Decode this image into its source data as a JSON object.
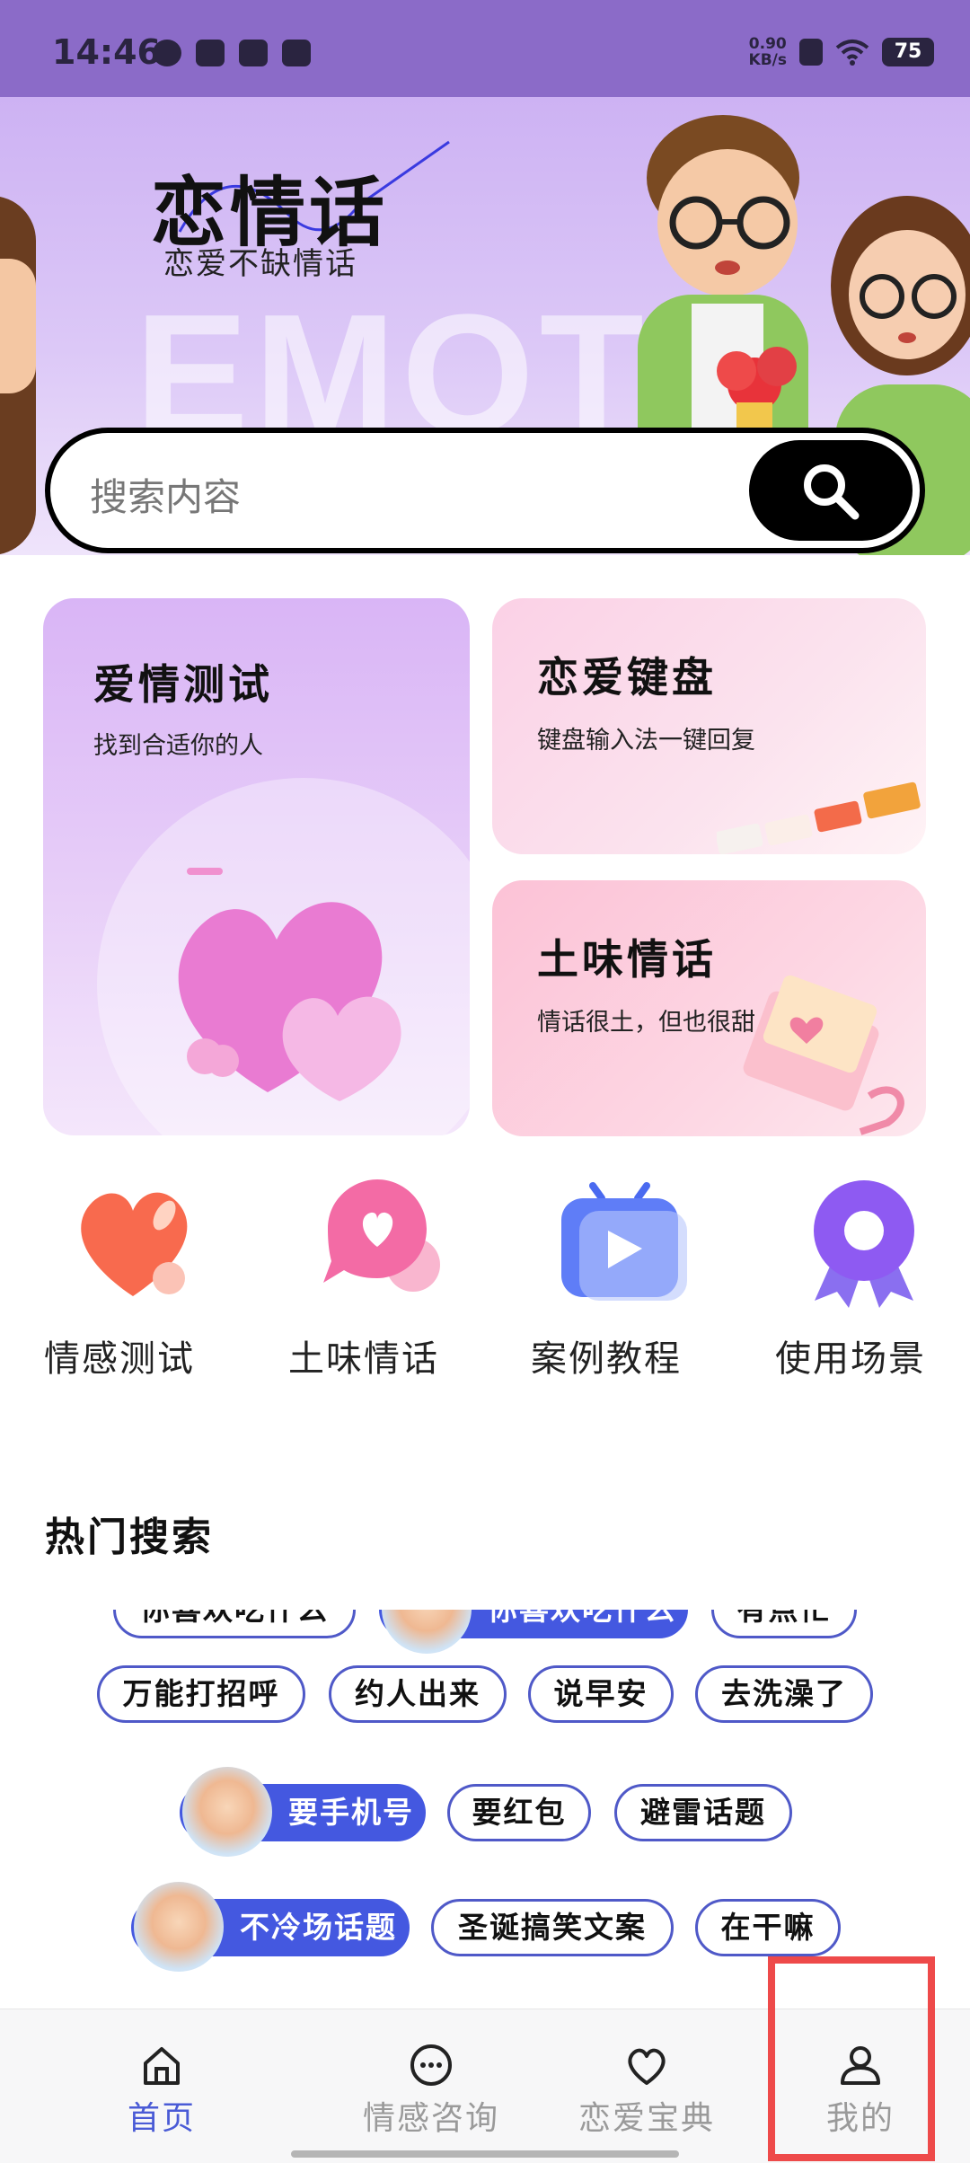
{
  "status_bar": {
    "time": "14:46",
    "net_speed_value": "0.90",
    "net_speed_unit": "KB/s",
    "battery": "75"
  },
  "banner": {
    "title": "恋情话",
    "subtitle": "恋爱不缺情话",
    "background_text": "EMOTI"
  },
  "search": {
    "placeholder": "搜索内容"
  },
  "cards": {
    "love_test": {
      "title": "爱情测试",
      "subtitle": "找到合适你的人"
    },
    "love_keyboard": {
      "title": "恋爱键盘",
      "subtitle": "键盘输入法一键回复"
    },
    "tuwei": {
      "title": "土味情话",
      "subtitle": "情话很土，但也很甜"
    }
  },
  "quick_icons": [
    {
      "label": "情感测试",
      "icon": "heart-icon"
    },
    {
      "label": "土味情话",
      "icon": "chat-bubble-heart-icon"
    },
    {
      "label": "案例教程",
      "icon": "tv-play-icon"
    },
    {
      "label": "使用场景",
      "icon": "badge-ribbon-icon"
    }
  ],
  "hot_search": {
    "title": "热门搜索",
    "row0": [
      "你喜欢吃什么",
      "你喜欢吃什么",
      "有点忙"
    ],
    "row1": [
      "万能打招呼",
      "约人出来",
      "说早安",
      "去洗澡了"
    ],
    "row2": [
      "要手机号",
      "要红包",
      "避雷话题"
    ],
    "row3": [
      "不冷场话题",
      "圣诞搞笑文案",
      "在干嘛"
    ]
  },
  "tabbar": {
    "items": [
      {
        "label": "首页",
        "icon": "home-icon",
        "active": true
      },
      {
        "label": "情感咨询",
        "icon": "chat-dots-icon",
        "active": false
      },
      {
        "label": "恋爱宝典",
        "icon": "heart-outline-icon",
        "active": false
      },
      {
        "label": "我的",
        "icon": "person-icon",
        "active": false
      }
    ]
  },
  "colors": {
    "status_bar": "#8b6bc8",
    "accent": "#4a5bd6",
    "tag_border": "#4f59c8",
    "tag_highlight": "#4458e0",
    "annotation_box": "#ee4a4a"
  }
}
